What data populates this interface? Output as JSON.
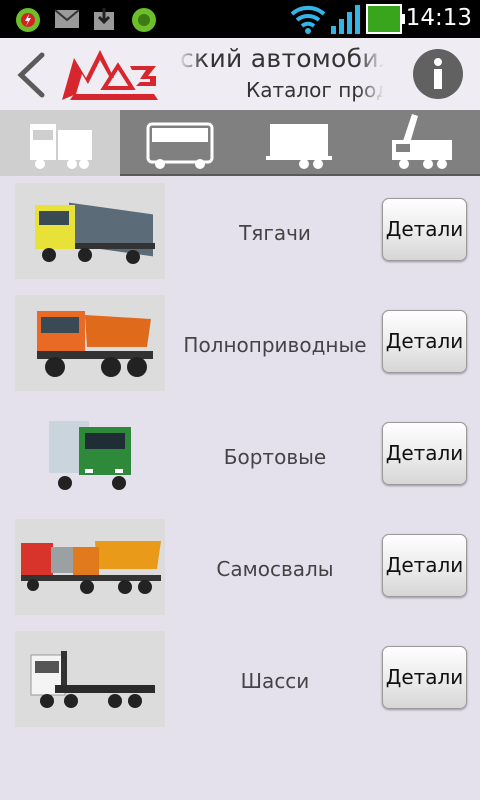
{
  "status_bar": {
    "time": "14:13",
    "icons": [
      "antivirus-alert-icon",
      "mail-icon",
      "download-icon",
      "antivirus-icon",
      "wifi-icon",
      "signal-icon",
      "battery-icon"
    ]
  },
  "header": {
    "title_line1": "ский автомобил",
    "title_line2": "Каталог проду",
    "brand_accent": "#d7262e"
  },
  "tabs": [
    {
      "name": "trucks",
      "active": true
    },
    {
      "name": "buses",
      "active": false
    },
    {
      "name": "trailers",
      "active": false
    },
    {
      "name": "cranes",
      "active": false
    }
  ],
  "products": [
    {
      "label": "Тягачи",
      "button": "Детали"
    },
    {
      "label": "Полноприводные",
      "button": "Детали"
    },
    {
      "label": "Бортовые",
      "button": "Детали"
    },
    {
      "label": "Самосвалы",
      "button": "Детали"
    },
    {
      "label": "Шасси",
      "button": "Детали"
    }
  ]
}
